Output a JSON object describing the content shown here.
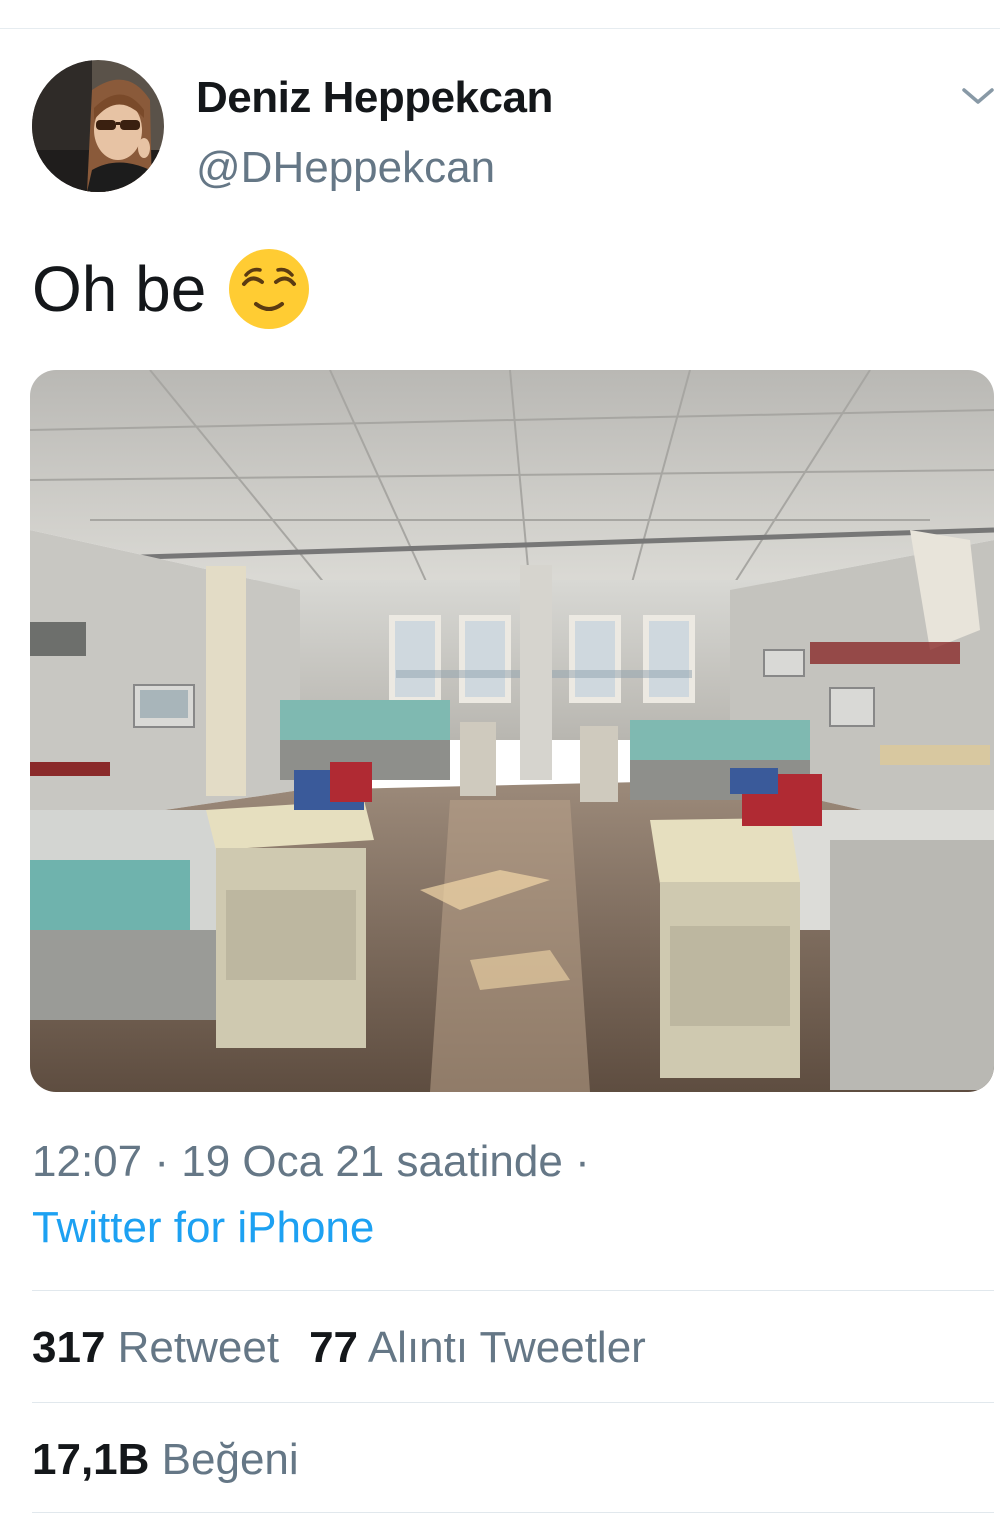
{
  "tweet": {
    "author_name": "Deniz Heppekcan",
    "author_handle": "@DHeppekcan",
    "text": "Oh be",
    "emoji_icon": "relieved-face-emoji",
    "time": "12:07",
    "separator": "·",
    "date": "19 Oca 21 saatinde",
    "trailing_separator": "·",
    "source": "Twitter for iPhone"
  },
  "stats": {
    "retweet_count": "317",
    "retweet_label": "Retweet",
    "quote_count": "77",
    "quote_label": "Alıntı Tweetler",
    "like_count": "17,1B",
    "like_label": "Beğeni"
  },
  "colors": {
    "link": "#1da1f2",
    "secondary_text": "#657786",
    "primary_text": "#14171a",
    "divider": "#e1e8ed"
  }
}
